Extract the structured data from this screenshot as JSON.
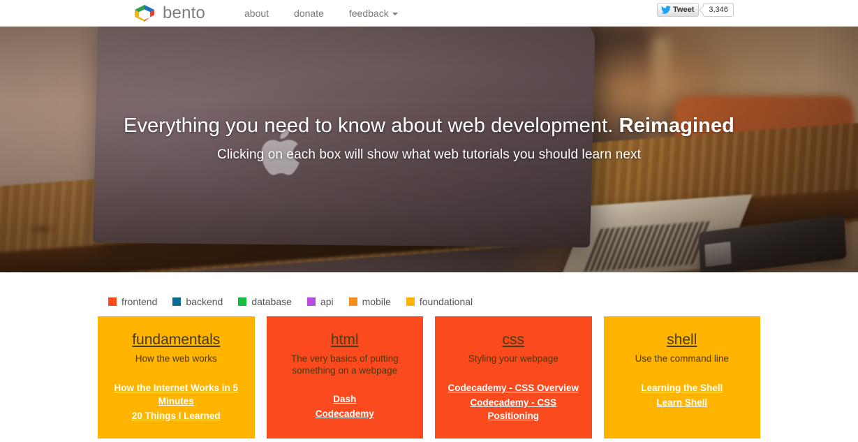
{
  "header": {
    "brand_name": "bento",
    "logo_icon": "bento-box-logo",
    "nav": [
      {
        "label": "about",
        "name": "about"
      },
      {
        "label": "donate",
        "name": "donate"
      },
      {
        "label": "feedback",
        "name": "feedback",
        "has_caret": true
      }
    ],
    "tweet": {
      "label": "Tweet",
      "count": "3,346",
      "icon": "twitter-bird-icon"
    }
  },
  "hero": {
    "title_main": "Everything you need to know about web development.",
    "title_strong": "Reimagined",
    "subtitle": "Clicking on each box will show what web tutorials you should learn next"
  },
  "legend": [
    {
      "label": "frontend",
      "color": "#FB4B1E"
    },
    {
      "label": "backend",
      "color": "#0A6E94"
    },
    {
      "label": "database",
      "color": "#13BE3F"
    },
    {
      "label": "api",
      "color": "#B54BDF"
    },
    {
      "label": "mobile",
      "color": "#F58C1C"
    },
    {
      "label": "foundational",
      "color": "#FFB400"
    }
  ],
  "cards": [
    {
      "title": "fundamentals",
      "subtitle": "How the web works",
      "color": "#FFB400",
      "category": "foundational",
      "links": [
        "How the Internet Works in 5 Minutes",
        "20 Things I Learned"
      ]
    },
    {
      "title": "html",
      "subtitle": "The very basics of putting something on a webpage",
      "color": "#FB4B1E",
      "category": "frontend",
      "links": [
        "Dash",
        "Codecademy"
      ]
    },
    {
      "title": "css",
      "subtitle": "Styling your webpage",
      "color": "#FB4B1E",
      "category": "frontend",
      "links": [
        "Codecademy - CSS Overview",
        "Codecademy - CSS Positioning"
      ]
    },
    {
      "title": "shell",
      "subtitle": "Use the command line",
      "color": "#FFB400",
      "category": "foundational",
      "links": [
        "Learning the Shell",
        "Learn Shell"
      ]
    }
  ]
}
